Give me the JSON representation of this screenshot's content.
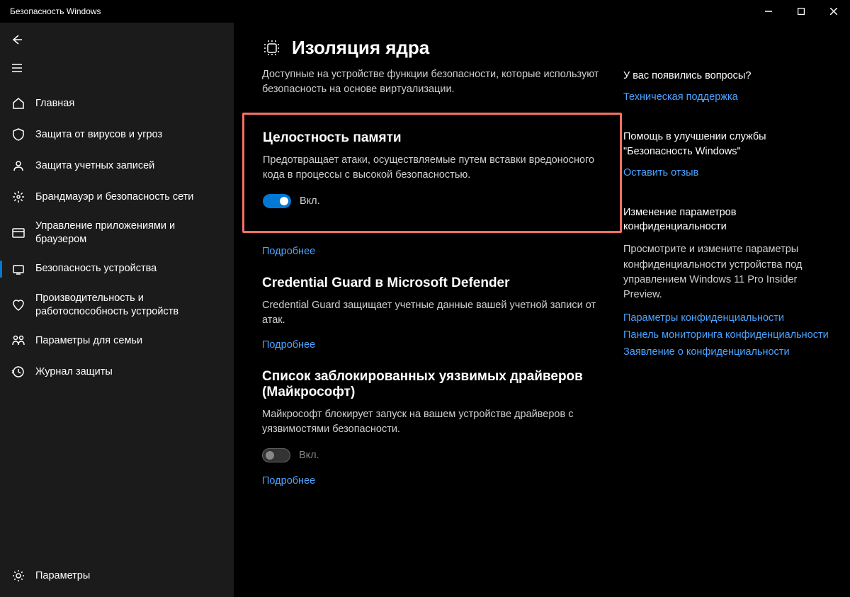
{
  "window": {
    "title": "Безопасность Windows"
  },
  "sidebar": {
    "items": [
      {
        "label": "Главная"
      },
      {
        "label": "Защита от вирусов и угроз"
      },
      {
        "label": "Защита учетных записей"
      },
      {
        "label": "Брандмауэр и безопасность сети"
      },
      {
        "label": "Управление приложениями и браузером"
      },
      {
        "label": "Безопасность устройства"
      },
      {
        "label": "Производительность и работоспособность устройств"
      },
      {
        "label": "Параметры для семьи"
      },
      {
        "label": "Журнал защиты"
      }
    ],
    "footer": {
      "label": "Параметры"
    }
  },
  "page": {
    "title": "Изоляция ядра",
    "description": "Доступные на устройстве функции безопасности, которые используют безопасность на основе виртуализации."
  },
  "sections": {
    "memory": {
      "title": "Целостность памяти",
      "desc": "Предотвращает атаки, осуществляемые путем вставки вредоносного кода в процессы с высокой безопасностью.",
      "toggle_label": "Вкл.",
      "learn_more": "Подробнее"
    },
    "credential": {
      "title": "Credential Guard в Microsoft Defender",
      "desc": "Credential Guard защищает учетные данные вашей учетной записи от атак.",
      "learn_more": "Подробнее"
    },
    "blocklist": {
      "title": "Список заблокированных уязвимых драйверов (Майкрософт)",
      "desc": "Майкрософт блокирует запуск на вашем устройстве драйверов с уязвимостями безопасности.",
      "toggle_label": "Вкл.",
      "learn_more": "Подробнее"
    }
  },
  "side": {
    "questions": {
      "heading": "У вас появились вопросы?",
      "link": "Техническая поддержка"
    },
    "improve": {
      "heading": "Помощь в улучшении службы \"Безопасность Windows\"",
      "link": "Оставить отзыв"
    },
    "privacy": {
      "heading": "Изменение параметров конфиденциальности",
      "desc": "Просмотрите и измените параметры конфиденциальности устройства под управлением Windows 11 Pro Insider Preview.",
      "links": [
        "Параметры конфиденциальности",
        "Панель мониторинга конфиденциальности",
        "Заявление о конфиденциальности"
      ]
    }
  }
}
